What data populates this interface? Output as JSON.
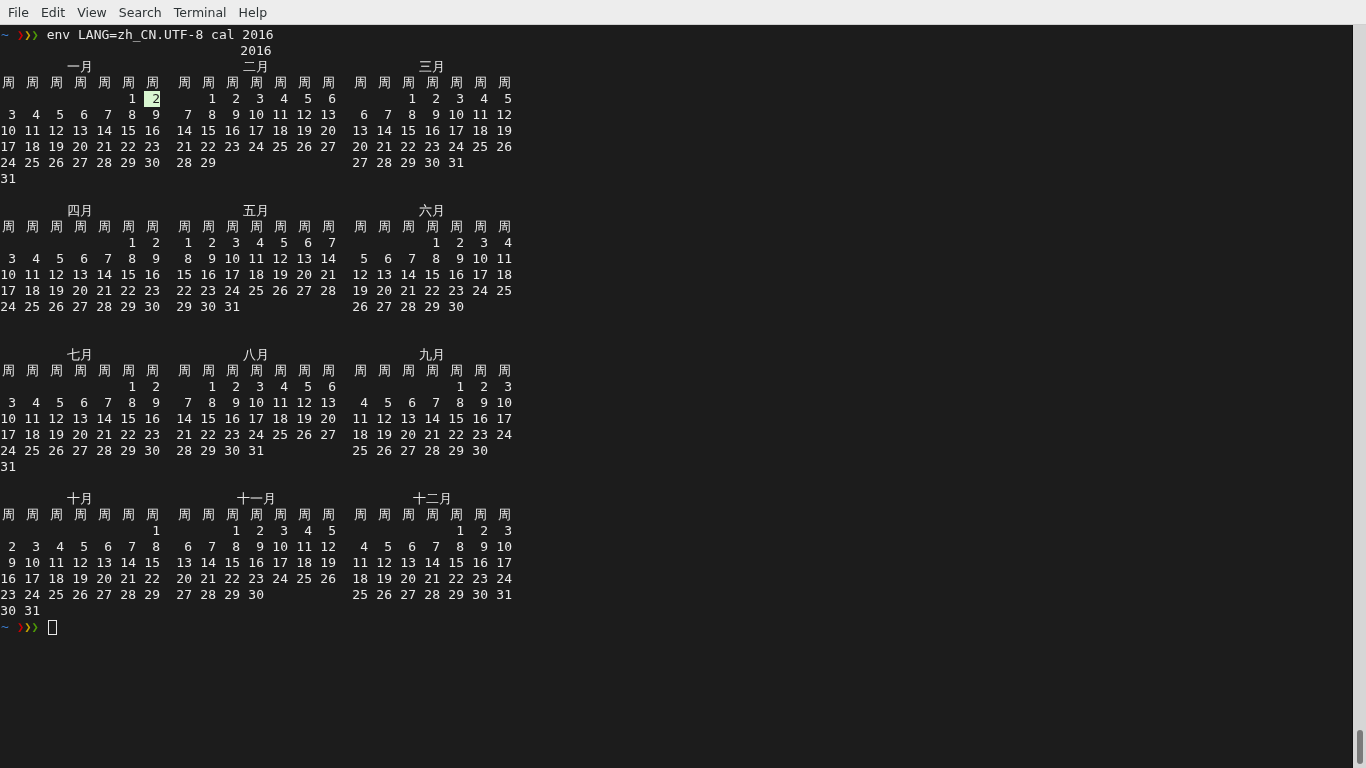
{
  "menu": [
    "File",
    "Edit",
    "View",
    "Search",
    "Terminal",
    "Help"
  ],
  "prompt": {
    "dir": "~",
    "arrows": [
      {
        "text": "❯",
        "color": "#cc0000"
      },
      {
        "text": "❯",
        "color": "#c4a000"
      },
      {
        "text": "❯",
        "color": "#4e9a06"
      }
    ],
    "command": "env LANG=zh_CN.UTF-8 cal 2016"
  },
  "calendar": {
    "year": "2016",
    "quarters": [
      {
        "months": [
          {
            "name": "一月",
            "weekdays": [
              "周",
              "周",
              "周",
              "周",
              "周",
              "周",
              "周"
            ],
            "weeks": [
              [
                "1",
                {
                  "text": "2",
                  "today": true
                }
              ],
              [
                "3",
                "4",
                "5",
                "6",
                "7",
                "8",
                "9"
              ],
              [
                "10",
                "11",
                "12",
                "13",
                "14",
                "15",
                "16"
              ],
              [
                "17",
                "18",
                "19",
                "20",
                "21",
                "22",
                "23"
              ],
              [
                "24",
                "25",
                "26",
                "27",
                "28",
                "29",
                "30"
              ],
              [
                "31"
              ]
            ]
          },
          {
            "name": "二月",
            "weekdays": [
              "周",
              "周",
              "周",
              "周",
              "周",
              "周",
              "周"
            ],
            "weeks": [
              [
                "1",
                "2",
                "3",
                "4",
                "5",
                "6"
              ],
              [
                "7",
                "8",
                "9",
                "10",
                "11",
                "12",
                "13"
              ],
              [
                "14",
                "15",
                "16",
                "17",
                "18",
                "19",
                "20"
              ],
              [
                "21",
                "22",
                "23",
                "24",
                "25",
                "26",
                "27"
              ],
              [
                "28",
                "29"
              ]
            ]
          },
          {
            "name": "三月",
            "weekdays": [
              "周",
              "周",
              "周",
              "周",
              "周",
              "周",
              "周"
            ],
            "weeks": [
              [
                "1",
                "2",
                "3",
                "4",
                "5"
              ],
              [
                "6",
                "7",
                "8",
                "9",
                "10",
                "11",
                "12"
              ],
              [
                "13",
                "14",
                "15",
                "16",
                "17",
                "18",
                "19"
              ],
              [
                "20",
                "21",
                "22",
                "23",
                "24",
                "25",
                "26"
              ],
              [
                "27",
                "28",
                "29",
                "30",
                "31"
              ]
            ]
          }
        ]
      },
      {
        "months": [
          {
            "name": "四月",
            "weekdays": [
              "周",
              "周",
              "周",
              "周",
              "周",
              "周",
              "周"
            ],
            "weeks": [
              [
                "1",
                "2"
              ],
              [
                "3",
                "4",
                "5",
                "6",
                "7",
                "8",
                "9"
              ],
              [
                "10",
                "11",
                "12",
                "13",
                "14",
                "15",
                "16"
              ],
              [
                "17",
                "18",
                "19",
                "20",
                "21",
                "22",
                "23"
              ],
              [
                "24",
                "25",
                "26",
                "27",
                "28",
                "29",
                "30"
              ]
            ]
          },
          {
            "name": "五月",
            "weekdays": [
              "周",
              "周",
              "周",
              "周",
              "周",
              "周",
              "周"
            ],
            "weeks": [
              [
                "1",
                "2",
                "3",
                "4",
                "5",
                "6",
                "7"
              ],
              [
                "8",
                "9",
                "10",
                "11",
                "12",
                "13",
                "14"
              ],
              [
                "15",
                "16",
                "17",
                "18",
                "19",
                "20",
                "21"
              ],
              [
                "22",
                "23",
                "24",
                "25",
                "26",
                "27",
                "28"
              ],
              [
                "29",
                "30",
                "31"
              ]
            ]
          },
          {
            "name": "六月",
            "weekdays": [
              "周",
              "周",
              "周",
              "周",
              "周",
              "周",
              "周"
            ],
            "weeks": [
              [
                "1",
                "2",
                "3",
                "4"
              ],
              [
                "5",
                "6",
                "7",
                "8",
                "9",
                "10",
                "11"
              ],
              [
                "12",
                "13",
                "14",
                "15",
                "16",
                "17",
                "18"
              ],
              [
                "19",
                "20",
                "21",
                "22",
                "23",
                "24",
                "25"
              ],
              [
                "26",
                "27",
                "28",
                "29",
                "30"
              ]
            ]
          }
        ]
      },
      {
        "months": [
          {
            "name": "七月",
            "weekdays": [
              "周",
              "周",
              "周",
              "周",
              "周",
              "周",
              "周"
            ],
            "weeks": [
              [
                "1",
                "2"
              ],
              [
                "3",
                "4",
                "5",
                "6",
                "7",
                "8",
                "9"
              ],
              [
                "10",
                "11",
                "12",
                "13",
                "14",
                "15",
                "16"
              ],
              [
                "17",
                "18",
                "19",
                "20",
                "21",
                "22",
                "23"
              ],
              [
                "24",
                "25",
                "26",
                "27",
                "28",
                "29",
                "30"
              ],
              [
                "31"
              ]
            ]
          },
          {
            "name": "八月",
            "weekdays": [
              "周",
              "周",
              "周",
              "周",
              "周",
              "周",
              "周"
            ],
            "weeks": [
              [
                "1",
                "2",
                "3",
                "4",
                "5",
                "6"
              ],
              [
                "7",
                "8",
                "9",
                "10",
                "11",
                "12",
                "13"
              ],
              [
                "14",
                "15",
                "16",
                "17",
                "18",
                "19",
                "20"
              ],
              [
                "21",
                "22",
                "23",
                "24",
                "25",
                "26",
                "27"
              ],
              [
                "28",
                "29",
                "30",
                "31"
              ]
            ]
          },
          {
            "name": "九月",
            "weekdays": [
              "周",
              "周",
              "周",
              "周",
              "周",
              "周",
              "周"
            ],
            "weeks": [
              [
                "1",
                "2",
                "3"
              ],
              [
                "4",
                "5",
                "6",
                "7",
                "8",
                "9",
                "10"
              ],
              [
                "11",
                "12",
                "13",
                "14",
                "15",
                "16",
                "17"
              ],
              [
                "18",
                "19",
                "20",
                "21",
                "22",
                "23",
                "24"
              ],
              [
                "25",
                "26",
                "27",
                "28",
                "29",
                "30"
              ]
            ]
          }
        ]
      },
      {
        "months": [
          {
            "name": "十月",
            "weekdays": [
              "周",
              "周",
              "周",
              "周",
              "周",
              "周",
              "周"
            ],
            "weeks": [
              [
                "1"
              ],
              [
                "2",
                "3",
                "4",
                "5",
                "6",
                "7",
                "8"
              ],
              [
                "9",
                "10",
                "11",
                "12",
                "13",
                "14",
                "15"
              ],
              [
                "16",
                "17",
                "18",
                "19",
                "20",
                "21",
                "22"
              ],
              [
                "23",
                "24",
                "25",
                "26",
                "27",
                "28",
                "29"
              ],
              [
                "30",
                "31"
              ]
            ]
          },
          {
            "name": "十一月",
            "weekdays": [
              "周",
              "周",
              "周",
              "周",
              "周",
              "周",
              "周"
            ],
            "weeks": [
              [
                "1",
                "2",
                "3",
                "4",
                "5"
              ],
              [
                "6",
                "7",
                "8",
                "9",
                "10",
                "11",
                "12"
              ],
              [
                "13",
                "14",
                "15",
                "16",
                "17",
                "18",
                "19"
              ],
              [
                "20",
                "21",
                "22",
                "23",
                "24",
                "25",
                "26"
              ],
              [
                "27",
                "28",
                "29",
                "30"
              ]
            ]
          },
          {
            "name": "十二月",
            "weekdays": [
              "周",
              "周",
              "周",
              "周",
              "周",
              "周",
              "周"
            ],
            "weeks": [
              [
                "1",
                "2",
                "3"
              ],
              [
                "4",
                "5",
                "6",
                "7",
                "8",
                "9",
                "10"
              ],
              [
                "11",
                "12",
                "13",
                "14",
                "15",
                "16",
                "17"
              ],
              [
                "18",
                "19",
                "20",
                "21",
                "22",
                "23",
                "24"
              ],
              [
                "25",
                "26",
                "27",
                "28",
                "29",
                "30",
                "31"
              ]
            ]
          }
        ]
      }
    ]
  },
  "prompt_after": {
    "dir": "~",
    "arrows": [
      {
        "text": "❯",
        "color": "#cc0000"
      },
      {
        "text": "❯",
        "color": "#c4a000"
      },
      {
        "text": "❯",
        "color": "#4e9a06"
      }
    ]
  }
}
